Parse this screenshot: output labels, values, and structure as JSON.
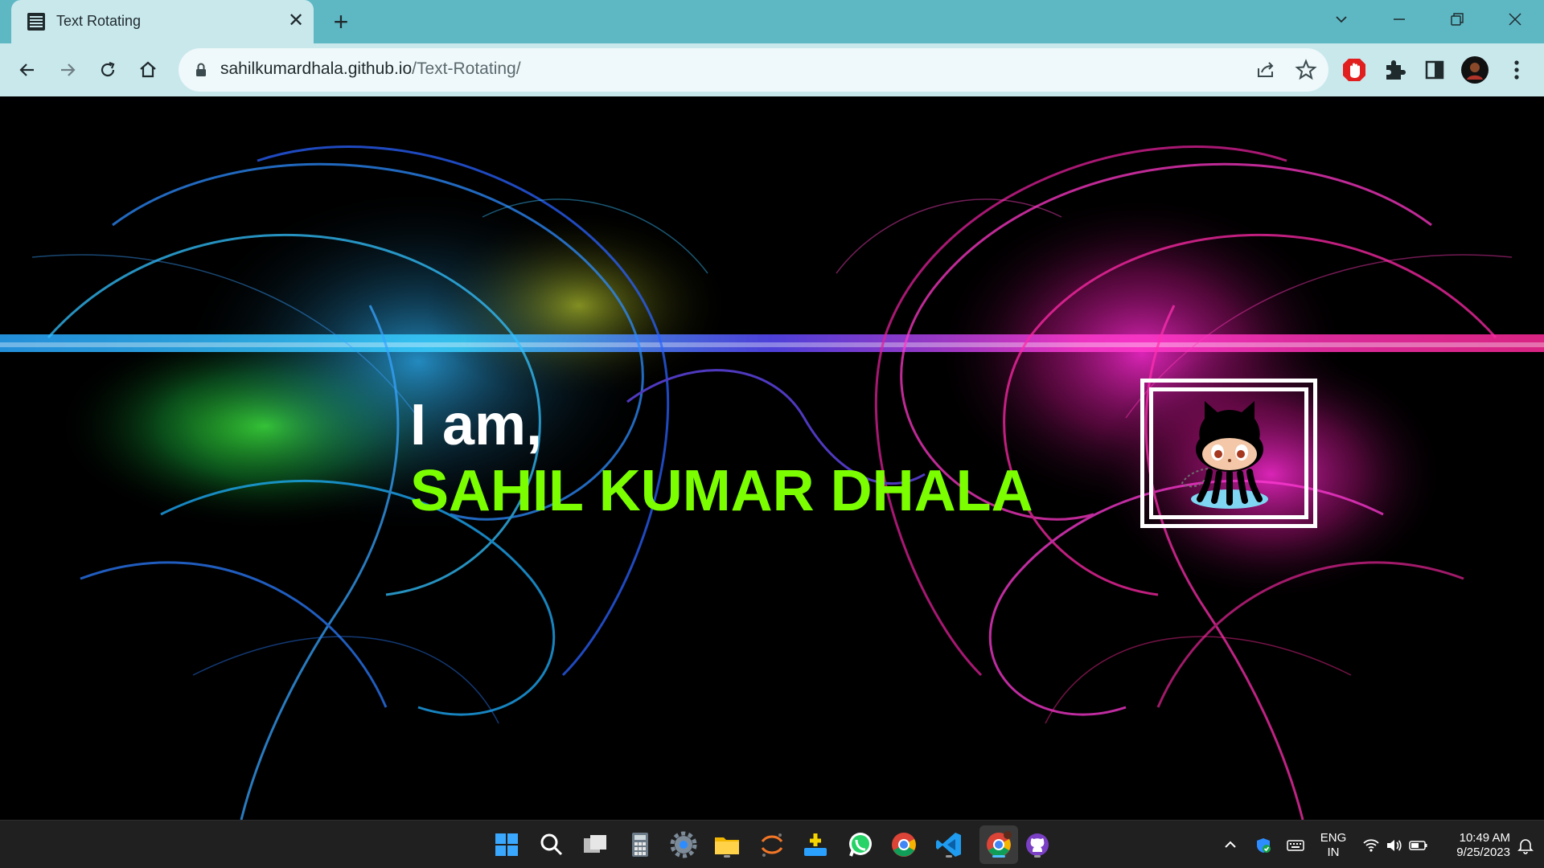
{
  "browser": {
    "tab": {
      "title": "Text Rotating",
      "favicon": "page-icon",
      "close_glyph": "✕"
    },
    "new_tab_glyph": "+",
    "url_host": "sahilkumardhala.github.io",
    "url_path": "/Text-Rotating/",
    "nav_icons": [
      "back-icon",
      "forward-icon",
      "reload-icon",
      "home-icon"
    ],
    "omnibox_icons": [
      "lock-icon",
      "share-icon",
      "bookmark-star-icon"
    ],
    "extension_icons": [
      "adblock-icon",
      "extensions-puzzle-icon",
      "side-panel-icon",
      "profile-avatar",
      "menu-kebab-icon"
    ],
    "window_controls": [
      "tab-search-icon",
      "minimize-icon",
      "restore-icon",
      "close-window-icon"
    ]
  },
  "page": {
    "intro": "I am,",
    "name": "SAHIL KUMAR DHALA",
    "logo": "github-octocat-logo",
    "colors": {
      "intro": "#ffffff",
      "name": "#7bff00",
      "frame": "#ffffff"
    }
  },
  "taskbar": {
    "apps": [
      "windows-start-icon",
      "search-icon",
      "task-view-icon",
      "calculator-icon",
      "settings-icon",
      "file-explorer-icon",
      "jupyter-icon",
      "app-installer-icon",
      "whatsapp-icon",
      "chrome-icon",
      "vscode-icon",
      "chrome-active-icon",
      "github-desktop-icon"
    ],
    "tray": {
      "language": "ENG",
      "region": "IN",
      "time": "10:49 AM",
      "date": "9/25/2023"
    }
  }
}
